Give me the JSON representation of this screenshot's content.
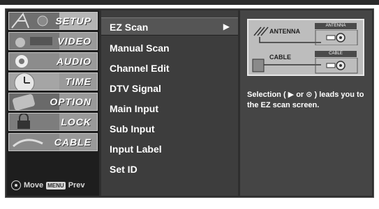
{
  "categories": [
    {
      "label": "SETUP"
    },
    {
      "label": "VIDEO"
    },
    {
      "label": "AUDIO"
    },
    {
      "label": "TIME"
    },
    {
      "label": "OPTION"
    },
    {
      "label": "LOCK"
    },
    {
      "label": "CABLE"
    }
  ],
  "footer": {
    "move_label": "Move",
    "menu_key": "MENU",
    "prev_label": "Prev"
  },
  "menu": {
    "items": [
      {
        "label": "EZ Scan"
      },
      {
        "label": "Manual Scan"
      },
      {
        "label": "Channel Edit"
      },
      {
        "label": "DTV Signal"
      },
      {
        "label": "Main Input"
      },
      {
        "label": "Sub Input"
      },
      {
        "label": "Input Label"
      },
      {
        "label": "Set ID"
      }
    ],
    "selected_arrow": "▶"
  },
  "diagram": {
    "antenna_label": "ANTENNA",
    "antenna_port_label": "ANTENNA",
    "cable_label": "CABLE",
    "cable_port_label": "CABLE"
  },
  "description": "Selection ( ▶ or ⊙ ) leads you to the EZ scan screen.",
  "icons": [
    "thumb-setup-icon",
    "thumb-video-icon",
    "thumb-audio-icon",
    "thumb-time-icon",
    "thumb-option-icon",
    "thumb-lock-icon",
    "thumb-cable-icon",
    "move-pad-icon",
    "arrow-right-icon"
  ],
  "colors": {
    "panel_bg": "#2e2e2e",
    "menu_bg": "#3d3d3d",
    "selected_bg": "#555555",
    "category_bg": "#9a9a9a"
  }
}
